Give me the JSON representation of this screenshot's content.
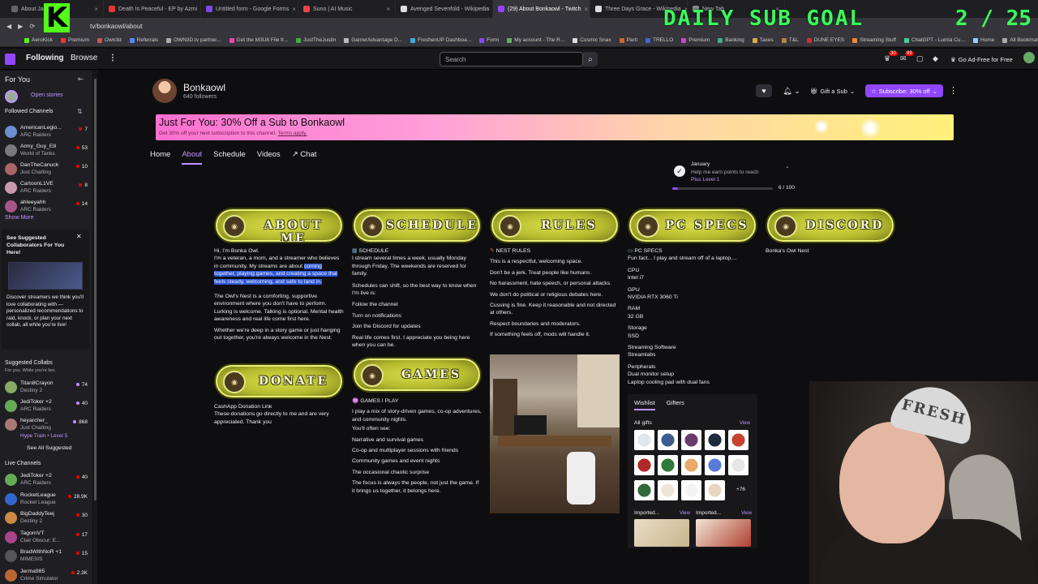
{
  "browser": {
    "tabs": [
      {
        "label": "About Jag",
        "color": "#666"
      },
      {
        "label": "Death Is Peaceful - EP by Azmi",
        "color": "#e33"
      },
      {
        "label": "Untitled form - Google Forms",
        "color": "#7a4ae8"
      },
      {
        "label": "Suno | AI Music",
        "color": "#e44"
      },
      {
        "label": "Avenged Sevenfold - Wikipedia",
        "color": "#ddd"
      },
      {
        "label": "(29) About Bonkaowl - Twitch",
        "color": "#9146ff"
      },
      {
        "label": "Three Days Grace - Wikipedia",
        "color": "#ddd"
      },
      {
        "label": "New Tab",
        "color": "#888"
      }
    ],
    "url": "tv/bonkaowl/about",
    "bookmarks": [
      "AeroKick",
      "Premium",
      "Own3d",
      "Referrals",
      "OWN3D.tv partner...",
      "Get the M3U8 File fr...",
      "JustTheJustin",
      "GamerAdvantage D...",
      "FreshenUP Dashboa...",
      "Form",
      "My account - The R...",
      "Cosmic Snax",
      "Parti",
      "TRELLO",
      "Premium",
      "Banking",
      "Taxes",
      "T&L",
      "DUNE EYES",
      "Streaming Stuff",
      "ChatGPT - Lumia Cu...",
      "Home",
      "All Bookmarks"
    ],
    "gemini": "Gemini"
  },
  "overlay": {
    "goal_label": "DAILY SUB GOAL",
    "goal_value": "2 / 25",
    "watermark": "The Justin"
  },
  "topnav": {
    "following": "Following",
    "browse": "Browse",
    "search_placeholder": "Search",
    "badge_notif": "30",
    "badge_inbox": "99",
    "adfree": "Go Ad-Free for Free"
  },
  "sidebar": {
    "for_you": "For You",
    "open_stories": "Open stories",
    "followed_header": "Followed Channels",
    "followed": [
      {
        "name": "AmericanLegio...",
        "game": "ARC Raiders",
        "count": "7",
        "color": "#6a8fd0"
      },
      {
        "name": "Army_Guy_E8",
        "game": "World of Tanks",
        "count": "53",
        "color": "#7a7a7a"
      },
      {
        "name": "DanTheCanuck",
        "game": "Just Chatting",
        "count": "10",
        "color": "#a66"
      },
      {
        "name": "CartoonL1VE",
        "game": "ARC Raiders",
        "count": "8",
        "color": "#c9a"
      },
      {
        "name": "ahleeyahh",
        "game": "ARC Raiders",
        "count": "14",
        "color": "#a58"
      }
    ],
    "show_more": "Show More",
    "collab_title": "See Suggested Collaborators For You Here!",
    "collab_text": "Discover streamers we think you'll love collaborating with — personalized recommendations to raid, knock, or plan your next collab, all while you're live!",
    "suggested_header": "Suggested Collabs",
    "suggested_sub": "For you. While you're live.",
    "suggested": [
      {
        "name": "Titan8Crayon",
        "game": "Destiny 2",
        "count": "74",
        "color": "#8a6"
      },
      {
        "name": "JediToker +2",
        "game": "ARC Raiders",
        "count": "40",
        "color": "#6a5"
      },
      {
        "name": "heyarcher_",
        "game": "Just Chatting",
        "count": "868",
        "color": "#a77"
      },
      {
        "name": "",
        "game": "Hype Train • Level 5",
        "count": "",
        "color": ""
      }
    ],
    "see_all": "See All Suggested",
    "live_header": "Live Channels",
    "live": [
      {
        "name": "JediToker +2",
        "game": "ARC Raiders",
        "count": "40",
        "color": "#6a5"
      },
      {
        "name": "RocketLeague",
        "game": "Rocket League",
        "count": "28.9K",
        "color": "#36c"
      },
      {
        "name": "BigDaddyTeej",
        "game": "Destiny 2",
        "count": "30",
        "color": "#c84"
      },
      {
        "name": "TagornVT",
        "game": "Clair Obscur: E...",
        "count": "17",
        "color": "#a48"
      },
      {
        "name": "BradWithNoR +1",
        "game": "MIMESIS",
        "count": "15",
        "color": "#555"
      },
      {
        "name": "Jerma985",
        "game": "Crime Simulator",
        "count": "2.3K",
        "color": "#b63"
      }
    ]
  },
  "channel": {
    "name": "Bonkaowl",
    "followers": "640 followers",
    "gift": "Gift a Sub",
    "subscribe": "Subscribe: 30% off",
    "promo_title": "Just For You: 30% Off a Sub to Bonkaowl",
    "promo_text": "Get 30% off your next subscription to this channel.",
    "promo_link": "Terms apply.",
    "tabs": [
      "Home",
      "About",
      "Schedule",
      "Videos",
      "Chat"
    ],
    "goal": {
      "l1": "January",
      "l2": "Help me earn points to reach",
      "l3": "Plus Level 1",
      "amount": "6 / 100",
      "progress": 0.06
    }
  },
  "panels": {
    "about": {
      "title": "ABOUT ME",
      "greeting": "Hi, I'm Bonka Owl.",
      "p1a": "I'm a veteran, a mom, and a streamer who believes in community. My streams are about ",
      "p1hl": "coming together, playing games, and creating a space that feels steady, welcoming, and safe to land in.",
      "p2": "The Owl's Nest is a comforting, supportive environment where you don't have to perform. Lurking is welcome. Talking is optional. Mental health awareness and real life come first here.",
      "p3": "Whether we're deep in a story game or just hanging out together, you're always welcome in the Nest."
    },
    "schedule": {
      "title": "SCHEDULE",
      "h": "SCHEDULE",
      "p1": "I stream several times a week, usually Monday through Friday. The weekends are reserved for family.",
      "p2": "Schedules can shift, so the best way to know when I'm live is:",
      "l1": "Follow the channel",
      "l2": "Turn on notifications",
      "l3": "Join the Discord for updates",
      "p3": "Real life comes first. I appreciate you being here when you can be."
    },
    "rules": {
      "title": "RULES",
      "h": "NEST RULES",
      "r1": "This is a respectful, welcoming space.",
      "r2": "Don't be a jerk. Treat people like humans.",
      "r3": "No harassment, hate speech, or personal attacks.",
      "r4": "We don't do political or religious debates here.",
      "r5": "Cussing is fine. Keep it reasonable and not directed at others.",
      "r6": "Respect boundaries and moderators.",
      "r7": "If something feels off, mods will handle it."
    },
    "pcspecs": {
      "title": "PC SPECS",
      "h": "PC SPECS",
      "intro": "Fun fact... I play and stream off of a laptop....",
      "cpu_l": "CPU",
      "cpu": "Intel i7",
      "gpu_l": "GPU",
      "gpu": "NVIDIA RTX 3060 Ti",
      "ram_l": "RAM",
      "ram": "32 GB",
      "st_l": "Storage",
      "st": "SSD",
      "sw_l": "Streaming Software",
      "sw": "Streamlabs",
      "per_l": "Peripherals",
      "per1": "Dual monitor setup",
      "per2": "Laptop cooling pad with dual fans"
    },
    "discord": {
      "title": "DISCORD",
      "text": "Bonka's Owl Nest"
    },
    "donate": {
      "title": "DONATE",
      "l1": "CashApp Donation Link",
      "l2": "These donations go directly to me and are very appreciated. Thank you"
    },
    "games": {
      "title": "GAMES",
      "h": "GAMES I PLAY",
      "p1": "I play a mix of story-driven games, co-op adventures, and community nights.",
      "p2": "You'll often see:",
      "g1": "Narrative and survival games",
      "g2": "Co-op and multiplayer sessions with friends",
      "g3": "Community games and event nights",
      "g4": "The occasional chaotic surprise",
      "p3": "The focus is always the people, not just the game. If it brings us together, it belongs here."
    },
    "owl": "Owl Nest"
  },
  "wishlist": {
    "tab1": "Wishlist",
    "tab2": "Gifters",
    "all": "All gifts",
    "view": "View",
    "more": "+76",
    "imp1": "Imported...",
    "imp2": "Imported..."
  },
  "webcam": {
    "hat": "FRESH"
  }
}
